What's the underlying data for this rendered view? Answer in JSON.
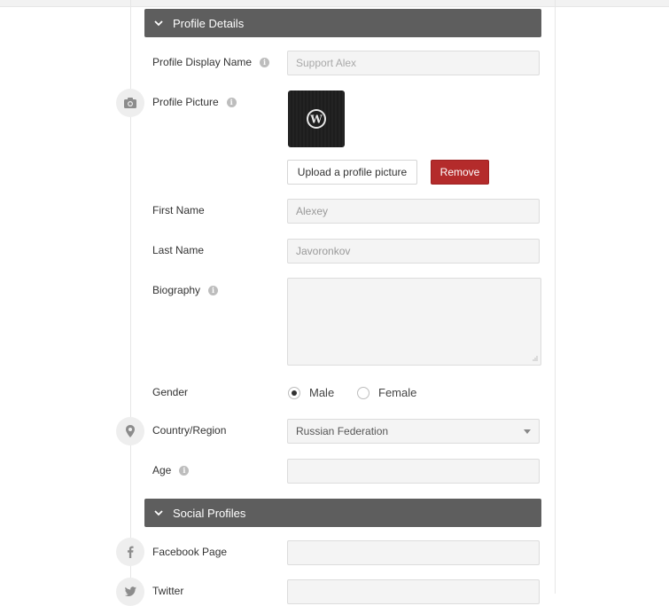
{
  "sections": {
    "profile_details": "Profile Details",
    "social_profiles": "Social Profiles"
  },
  "fields": {
    "display_name": {
      "label": "Profile Display Name",
      "placeholder": "Support Alex"
    },
    "profile_picture": {
      "label": "Profile Picture"
    },
    "first_name": {
      "label": "First Name",
      "value": "Alexey"
    },
    "last_name": {
      "label": "Last Name",
      "value": "Javoronkov"
    },
    "biography": {
      "label": "Biography",
      "value": ""
    },
    "gender": {
      "label": "Gender",
      "options": [
        "Male",
        "Female"
      ],
      "selected": "Male"
    },
    "country": {
      "label": "Country/Region",
      "value": "Russian Federation"
    },
    "age": {
      "label": "Age",
      "value": ""
    },
    "facebook": {
      "label": "Facebook Page",
      "value": ""
    },
    "twitter": {
      "label": "Twitter",
      "value": ""
    }
  },
  "buttons": {
    "upload": "Upload a profile picture",
    "remove": "Remove"
  },
  "icons": {
    "info": "i",
    "camera": "camera-icon",
    "location": "map-pin-icon",
    "facebook": "facebook-icon",
    "twitter": "twitter-icon",
    "avatar_logo": "W"
  },
  "colors": {
    "section_header": "#5e5e5e",
    "remove_button": "#b42b2b"
  }
}
